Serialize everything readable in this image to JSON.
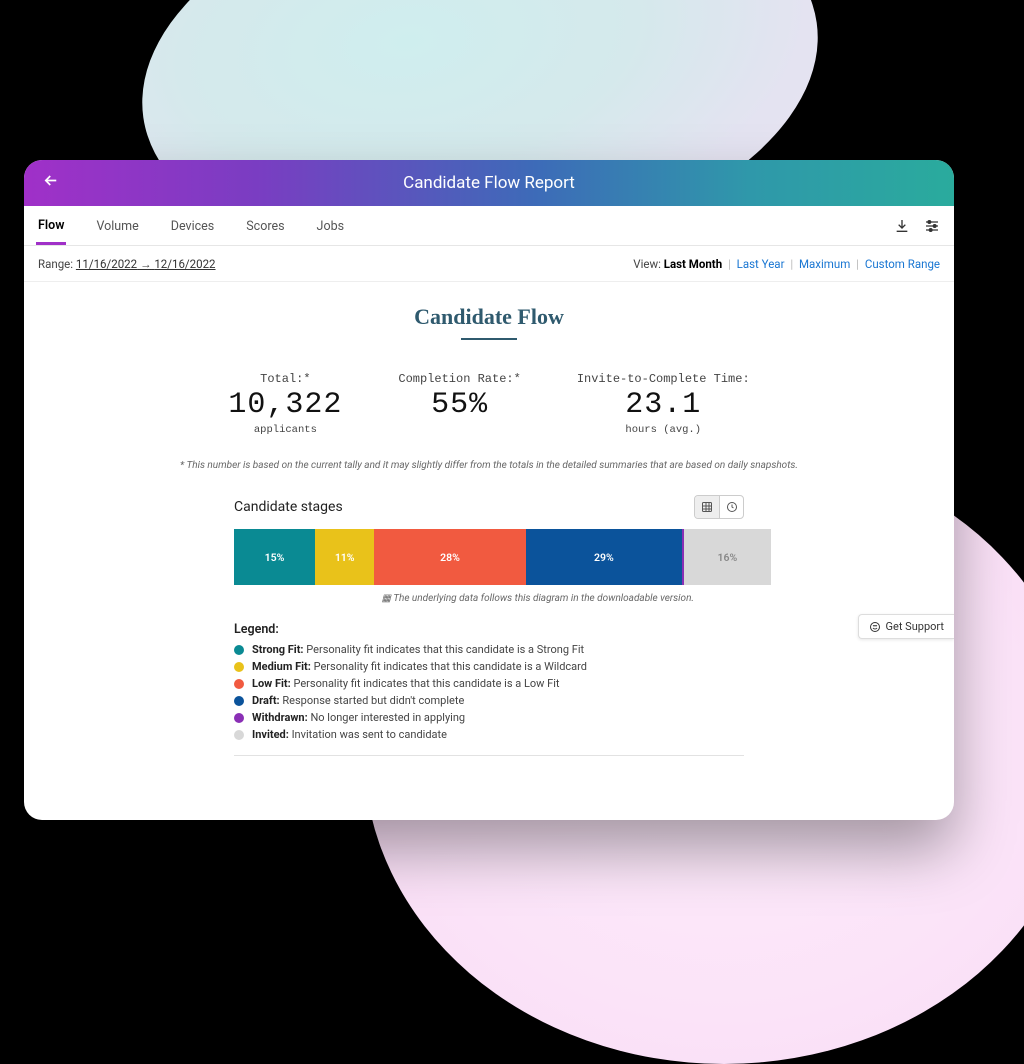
{
  "header": {
    "title": "Candidate Flow Report"
  },
  "tabs": [
    "Flow",
    "Volume",
    "Devices",
    "Scores",
    "Jobs"
  ],
  "range": {
    "label": "Range:",
    "from": "11/16/2022",
    "to": "12/16/2022",
    "arrow": "→"
  },
  "view": {
    "label": "View:",
    "active": "Last Month",
    "opts": [
      "Last Year",
      "Maximum",
      "Custom Range"
    ]
  },
  "page_title": "Candidate Flow",
  "stats": {
    "total": {
      "label": "Total:*",
      "value": "10,322",
      "sub": "applicants"
    },
    "completion": {
      "label": "Completion Rate:*",
      "value": "55%"
    },
    "invite": {
      "label": "Invite-to-Complete Time:",
      "value": "23.1",
      "sub": "hours (avg.)"
    }
  },
  "footnote": "* This number is based on the current tally and it may slightly differ from the totals in the detailed summaries that are based on daily snapshots.",
  "stages_label": "Candidate stages",
  "bar_note": "The underlying data follows this diagram in the downloadable version.",
  "legend_title": "Legend:",
  "legend": [
    {
      "color": "#0a8a93",
      "name": "Strong Fit:",
      "desc": "Personality fit indicates that this candidate is a Strong Fit"
    },
    {
      "color": "#e9c21a",
      "name": "Medium Fit:",
      "desc": "Personality fit indicates that this candidate is a Wildcard"
    },
    {
      "color": "#f15a40",
      "name": "Low Fit:",
      "desc": "Personality fit indicates that this candidate is a Low Fit"
    },
    {
      "color": "#0b539b",
      "name": "Draft:",
      "desc": "Response started but didn't complete"
    },
    {
      "color": "#8a2fb5",
      "name": "Withdrawn:",
      "desc": "No longer interested in applying"
    },
    {
      "color": "#d8d8d8",
      "name": "Invited:",
      "desc": "Invitation was sent to candidate"
    }
  ],
  "support_label": "Get Support",
  "chart_data": {
    "type": "bar",
    "title": "Candidate stages",
    "categories": [
      "Strong Fit",
      "Medium Fit",
      "Low Fit",
      "Draft",
      "Withdrawn",
      "Invited"
    ],
    "values": [
      15,
      11,
      28,
      29,
      1,
      16
    ],
    "unit": "percent",
    "colors": [
      "#0a8a93",
      "#e9c21a",
      "#f15a40",
      "#0b539b",
      "#8a2fb5",
      "#d8d8d8"
    ],
    "labels": [
      "15%",
      "11%",
      "28%",
      "29%",
      "",
      "16%"
    ],
    "orientation": "horizontal-stacked"
  }
}
